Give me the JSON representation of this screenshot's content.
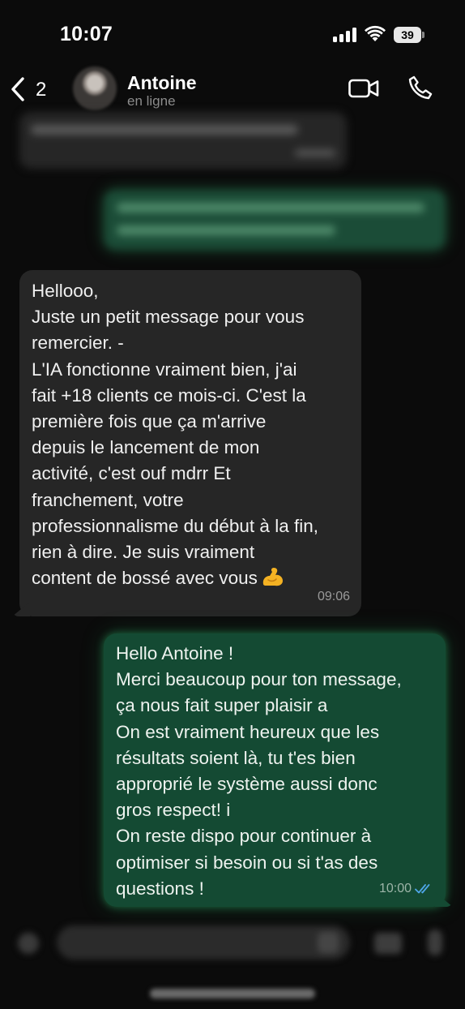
{
  "status_bar": {
    "time": "10:07",
    "battery_level": "39",
    "icons": [
      "cellular-signal-icon",
      "wifi-icon",
      "battery-icon"
    ]
  },
  "header": {
    "back_count": "2",
    "contact_name": "Antoine",
    "contact_status": "en ligne",
    "icons": [
      "back-chevron-icon",
      "video-call-icon",
      "phone-call-icon"
    ]
  },
  "messages": [
    {
      "direction": "incoming",
      "lines": [
        "Hellooo,",
        "Juste un petit message pour vous",
        "remercier. -",
        "L'IA fonctionne vraiment bien, j'ai",
        "fait +18 clients ce mois-ci. C'est la",
        "première fois que ça m'arrive",
        "depuis le lancement de mon",
        "activité, c'est ouf mdrr Et",
        "franchement, votre",
        "professionnalisme du début à la fin,",
        "rien à dire. Je suis vraiment",
        "content de bossé avec vous"
      ],
      "emoji": "flexed-biceps-emoji",
      "time": "09:06"
    },
    {
      "direction": "outgoing",
      "lines": [
        "Hello Antoine !",
        "Merci beaucoup pour ton message,",
        "ça nous fait super plaisir a",
        "On est vraiment heureux que les",
        "résultats soient là, tu t'es bien",
        "approprié le système aussi donc",
        "gros respect! i",
        "On reste dispo pour continuer à",
        "optimiser si besoin ou si t'as des",
        "questions !"
      ],
      "time": "10:00",
      "read_status": "read",
      "tick_color": "#4fa6e8"
    }
  ],
  "colors": {
    "background": "#0b0b0b",
    "incoming_bubble": "#262626",
    "outgoing_bubble": "#144a33",
    "outgoing_glow": "#2caa64"
  }
}
